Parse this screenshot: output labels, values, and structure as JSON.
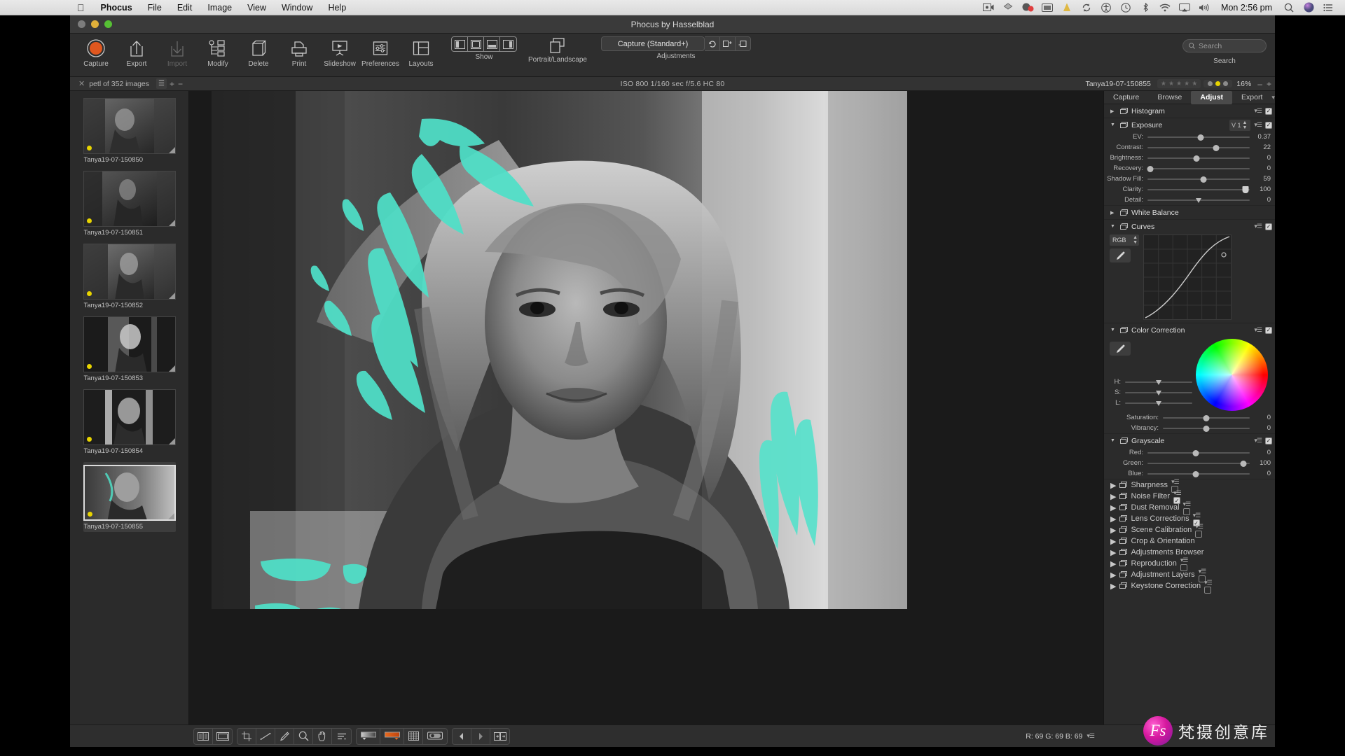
{
  "menubar": {
    "apple_icon": "apple-icon",
    "items": [
      {
        "label": "Phocus",
        "bold": true
      },
      {
        "label": "File",
        "bold": false
      },
      {
        "label": "Edit",
        "bold": false
      },
      {
        "label": "Image",
        "bold": false
      },
      {
        "label": "View",
        "bold": false
      },
      {
        "label": "Window",
        "bold": false
      },
      {
        "label": "Help",
        "bold": false
      }
    ],
    "status_icons": [
      "screen-record-icon",
      "dropbox-icon",
      "record-dot-icon",
      "display-icon",
      "cone-icon",
      "sync-icon",
      "accessibility-icon",
      "time-machine-icon",
      "bluetooth-icon",
      "wifi-icon",
      "airplay-icon",
      "volume-icon"
    ],
    "clock": "Mon 2:56 pm",
    "search_icon": "spotlight-search-icon",
    "siri_icon": "siri-icon",
    "controlcenter_icon": "notification-center-icon"
  },
  "window": {
    "title": "Phocus by Hasselblad",
    "traffic": [
      "close",
      "minimize",
      "zoom"
    ]
  },
  "toolbar": {
    "items": [
      {
        "label": "Capture",
        "icon": "capture-icon",
        "dim": false
      },
      {
        "label": "Export",
        "icon": "export-icon",
        "dim": false
      },
      {
        "label": "Import",
        "icon": "import-icon",
        "dim": true
      },
      {
        "label": "Modify",
        "icon": "modify-icon",
        "dim": false
      },
      {
        "label": "Delete",
        "icon": "delete-icon",
        "dim": false
      },
      {
        "label": "Print",
        "icon": "print-icon",
        "dim": false
      },
      {
        "label": "Slideshow",
        "icon": "slideshow-icon",
        "dim": false
      },
      {
        "label": "Preferences",
        "icon": "preferences-icon",
        "dim": false
      },
      {
        "label": "Layouts",
        "icon": "layouts-icon",
        "dim": false
      }
    ],
    "show_label": "Show",
    "portrait_label": "Portrait/Landscape",
    "adjustments_label": "Adjustments",
    "adjustments_value": "Capture (Standard+)",
    "search_label": "Search",
    "search_placeholder": "Search"
  },
  "subbar": {
    "browser_title": "petl of 352 images",
    "close_icon": "close-icon",
    "exif": "ISO 800  1/160 sec  f/5.6  HC 80",
    "filename": "Tanya19-07-150855",
    "stars": 5,
    "star_rating": 0,
    "labels": [
      {
        "on": false
      },
      {
        "on": true
      },
      {
        "on": false
      }
    ],
    "zoom": "16%",
    "zoom_out": "–",
    "zoom_in": "+"
  },
  "browser": {
    "thumbnails": [
      {
        "name": "Tanya19-07-150850",
        "selected": false,
        "flag": "yellow"
      },
      {
        "name": "Tanya19-07-150851",
        "selected": false,
        "flag": "yellow"
      },
      {
        "name": "Tanya19-07-150852",
        "selected": false,
        "flag": "yellow"
      },
      {
        "name": "Tanya19-07-150853",
        "selected": false,
        "flag": "yellow"
      },
      {
        "name": "Tanya19-07-150854",
        "selected": false,
        "flag": "yellow"
      },
      {
        "name": "Tanya19-07-150855",
        "selected": true,
        "flag": "yellow"
      }
    ]
  },
  "rightpanel": {
    "tabs": [
      {
        "label": "Capture",
        "active": false
      },
      {
        "label": "Browse",
        "active": false
      },
      {
        "label": "Adjust",
        "active": true
      },
      {
        "label": "Export",
        "active": false
      }
    ],
    "menu_icon": "panel-menu-icon",
    "histogram": {
      "title": "Histogram",
      "expanded": false,
      "enabled": true,
      "has_menu": true
    },
    "exposure": {
      "title": "Exposure",
      "expanded": true,
      "enabled": true,
      "version": "V 1",
      "sliders": [
        {
          "label": "EV:",
          "value": "0.37",
          "pos": 52,
          "style": "round"
        },
        {
          "label": "Contrast:",
          "value": "22",
          "pos": 67,
          "style": "round"
        },
        {
          "label": "Brightness:",
          "value": "0",
          "pos": 48,
          "style": "round"
        },
        {
          "label": "Recovery:",
          "value": "0",
          "pos": 2,
          "style": "round"
        },
        {
          "label": "Shadow Fill:",
          "value": "59",
          "pos": 55,
          "style": "round"
        },
        {
          "label": "Clarity:",
          "value": "100",
          "pos": 96,
          "style": "pent"
        },
        {
          "label": "Detail:",
          "value": "0",
          "pos": 50,
          "style": "tri"
        }
      ]
    },
    "white_balance": {
      "title": "White Balance",
      "expanded": false,
      "enabled": false,
      "has_menu": false
    },
    "curves": {
      "title": "Curves",
      "expanded": true,
      "enabled": true,
      "channel": "RGB",
      "eyedropper_icon": "eyedropper-icon"
    },
    "color_correction": {
      "title": "Color Correction",
      "expanded": true,
      "enabled": true,
      "eyedropper_icon": "eyedropper-icon",
      "hsl": [
        {
          "label": "H:",
          "pos": 50
        },
        {
          "label": "S:",
          "pos": 50
        },
        {
          "label": "L:",
          "pos": 50
        }
      ],
      "sliders": [
        {
          "label": "Saturation:",
          "value": "0",
          "pos": 50
        },
        {
          "label": "Vibrancy:",
          "value": "0",
          "pos": 50
        }
      ]
    },
    "grayscale": {
      "title": "Grayscale",
      "expanded": true,
      "enabled": true,
      "sliders": [
        {
          "label": "Red:",
          "value": "0",
          "pos": 47
        },
        {
          "label": "Green:",
          "value": "100",
          "pos": 94
        },
        {
          "label": "Blue:",
          "value": "0",
          "pos": 47
        }
      ]
    },
    "collapsed_sections": [
      {
        "title": "Sharpness",
        "enabled": false,
        "has_menu": true
      },
      {
        "title": "Noise Filter",
        "enabled": true,
        "has_menu": true
      },
      {
        "title": "Dust Removal",
        "enabled": false,
        "has_menu": true
      },
      {
        "title": "Lens Corrections",
        "enabled": true,
        "has_menu": true
      },
      {
        "title": "Scene Calibration",
        "enabled": false,
        "has_menu": true
      },
      {
        "title": "Crop & Orientation",
        "enabled": null,
        "has_menu": false
      },
      {
        "title": "Adjustments Browser",
        "enabled": null,
        "has_menu": false
      },
      {
        "title": "Reproduction",
        "enabled": false,
        "has_menu": true
      },
      {
        "title": "Adjustment Layers",
        "enabled": false,
        "has_menu": true
      },
      {
        "title": "Keystone Correction",
        "enabled": false,
        "has_menu": true
      }
    ]
  },
  "bottombar": {
    "view_tools": [
      "split-view-icon",
      "single-view-icon"
    ],
    "edit_tools": [
      "crop-icon",
      "straighten-icon",
      "retouch-brush-icon",
      "zoom-loupe-icon",
      "hand-pan-icon",
      "levels-icon"
    ],
    "display_tools": [
      "gradient-icon",
      "color-strip-icon",
      "grid-overlay-icon",
      "proof-icon"
    ],
    "nav_tools": [
      "previous-icon",
      "next-icon",
      "compare-icon"
    ],
    "rgb_readout": "R:  69 G:  69 B:  69",
    "readout_menu_icon": "readout-menu-icon"
  },
  "watermark": {
    "logo_text": "Fs",
    "text": "梵摄创意库"
  },
  "colors": {
    "accent_teal": "#4fe0c8",
    "capture_orange": "#e0571f",
    "label_yellow": "#e8d400",
    "panel_bg": "#2b2b2b",
    "toolbar_bg": "#2e2e2e"
  }
}
